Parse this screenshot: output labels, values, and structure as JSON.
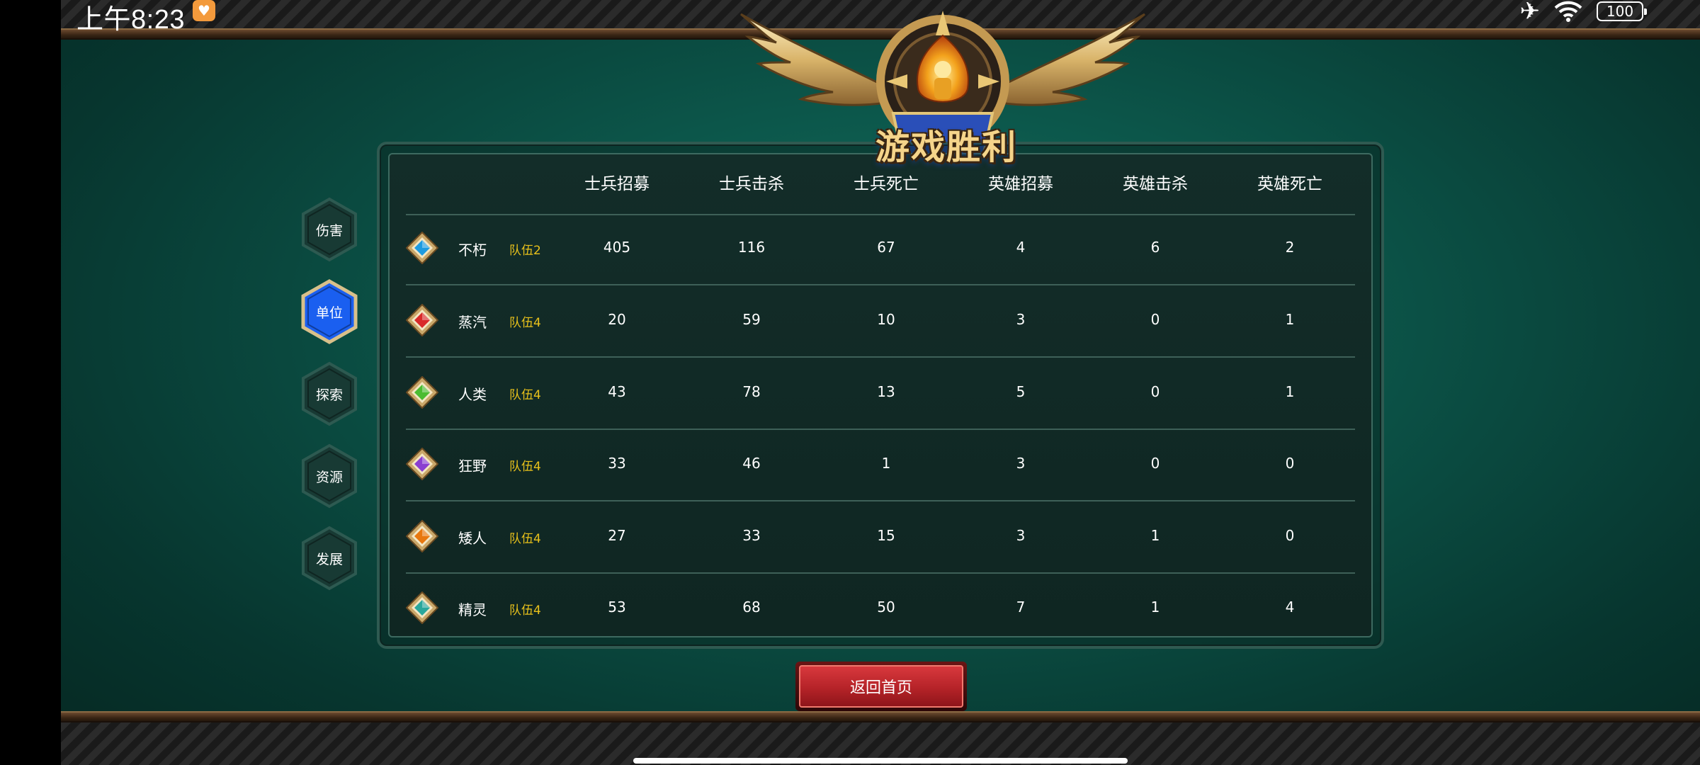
{
  "status_bar": {
    "time": "上午8:23",
    "battery": "100"
  },
  "header": {
    "title": "游戏胜利"
  },
  "side_tabs": [
    {
      "label": "伤害",
      "active": false
    },
    {
      "label": "单位",
      "active": true
    },
    {
      "label": "探索",
      "active": false
    },
    {
      "label": "资源",
      "active": false
    },
    {
      "label": "发展",
      "active": false
    }
  ],
  "table": {
    "columns": [
      "士兵招募",
      "士兵击杀",
      "士兵死亡",
      "英雄招募",
      "英雄击杀",
      "英雄死亡"
    ],
    "rows": [
      {
        "faction": "不朽",
        "team": "队伍2",
        "gem_color": "#1e9be0",
        "values": [
          "405",
          "116",
          "67",
          "4",
          "6",
          "2"
        ]
      },
      {
        "faction": "蒸汽",
        "team": "队伍4",
        "gem_color": "#d92a2a",
        "values": [
          "20",
          "59",
          "10",
          "3",
          "0",
          "1"
        ]
      },
      {
        "faction": "人类",
        "team": "队伍4",
        "gem_color": "#4cbc32",
        "values": [
          "43",
          "78",
          "13",
          "5",
          "0",
          "1"
        ]
      },
      {
        "faction": "狂野",
        "team": "队伍4",
        "gem_color": "#8a3fd1",
        "values": [
          "33",
          "46",
          "1",
          "3",
          "0",
          "0"
        ]
      },
      {
        "faction": "矮人",
        "team": "队伍4",
        "gem_color": "#e8780f",
        "values": [
          "27",
          "33",
          "15",
          "3",
          "1",
          "0"
        ]
      },
      {
        "faction": "精灵",
        "team": "队伍4",
        "gem_color": "#2aa79c",
        "values": [
          "53",
          "68",
          "50",
          "7",
          "1",
          "4"
        ]
      }
    ]
  },
  "footer": {
    "return_button": "返回首页"
  },
  "colors": {
    "team_label": "#e8c11b",
    "active_tab": "#1a5ff0",
    "button_red": "#c5262b"
  },
  "icons": [
    "airplane-icon",
    "wifi-icon",
    "battery-icon",
    "victory-emblem-icon",
    "faction-gem-icon"
  ]
}
